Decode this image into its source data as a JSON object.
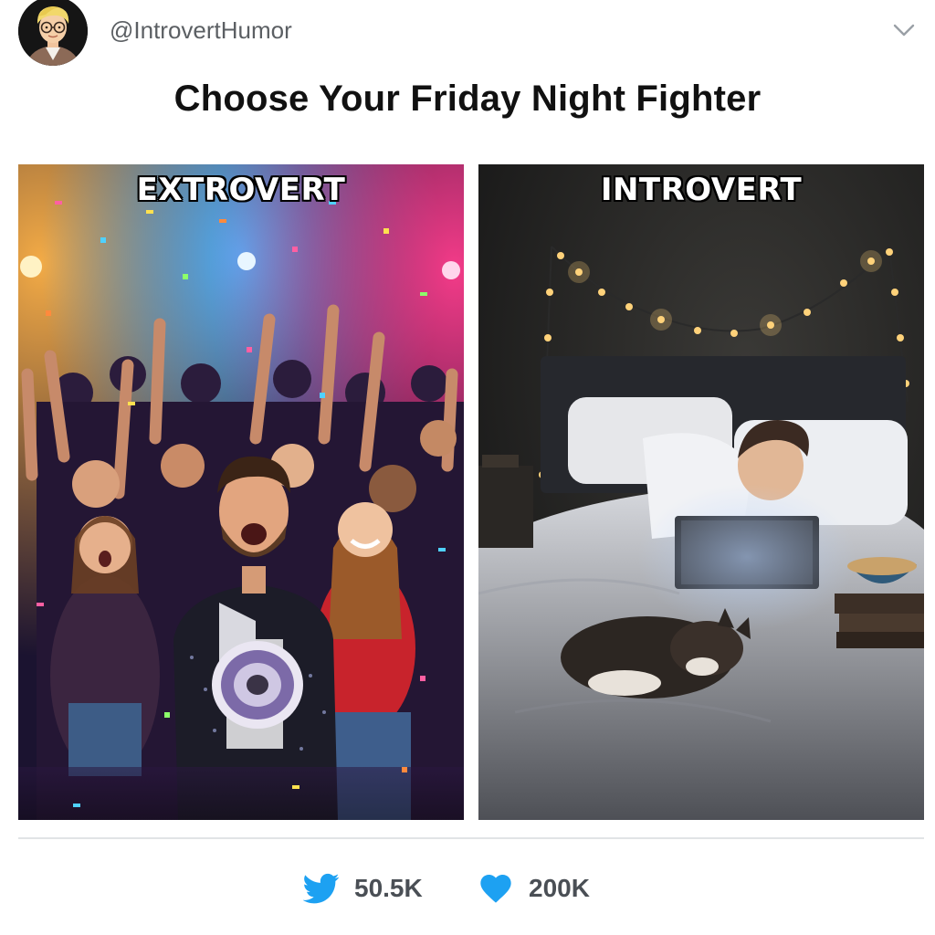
{
  "post": {
    "handle": "@IntrovertHumor",
    "title": "Choose Your Friday Night Fighter"
  },
  "panels": [
    {
      "label": "EXTROVERT",
      "scene": "crowded party with confetti, neon lights and a man shouting into a megaphone"
    },
    {
      "label": "INTROVERT",
      "scene": "dim bedroom with string lights, person in bed with laptop, sleeping cat and bowl of popcorn"
    }
  ],
  "stats": {
    "retweets": "50.5K",
    "likes": "200K"
  },
  "icons": {
    "menu": "chevron-down-icon",
    "retweet": "bird-icon",
    "like": "heart-icon"
  },
  "colors": {
    "accent": "#1da1f2",
    "text": "#14171a",
    "muted": "#5b5f63"
  }
}
